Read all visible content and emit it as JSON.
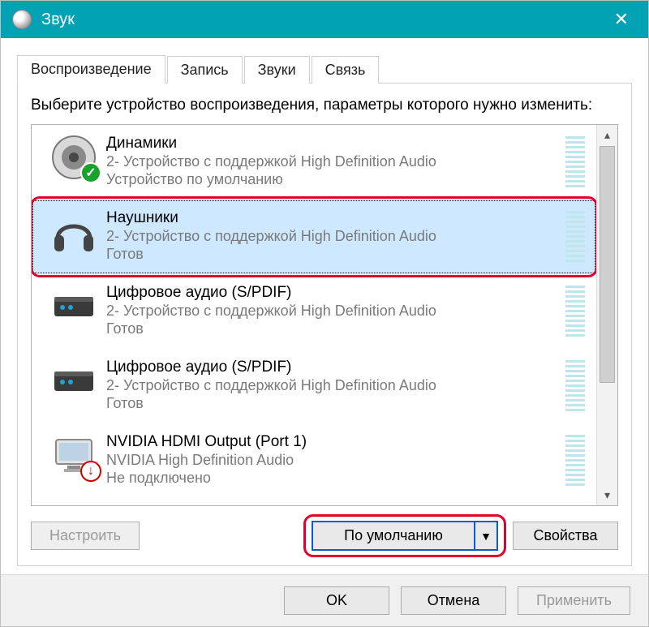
{
  "window": {
    "title": "Звук"
  },
  "tabs": [
    {
      "label": "Воспроизведение",
      "active": true
    },
    {
      "label": "Запись",
      "active": false
    },
    {
      "label": "Звуки",
      "active": false
    },
    {
      "label": "Связь",
      "active": false
    }
  ],
  "instruction": "Выберите устройство воспроизведения, параметры которого нужно изменить:",
  "devices": [
    {
      "name": "Динамики",
      "desc": "2- Устройство с поддержкой High Definition Audio",
      "status": "Устройство по умолчанию",
      "icon": "speaker",
      "badge": "default",
      "selected": false,
      "highlighted": false
    },
    {
      "name": "Наушники",
      "desc": "2- Устройство с поддержкой High Definition Audio",
      "status": "Готов",
      "icon": "headphones",
      "badge": null,
      "selected": true,
      "highlighted": true
    },
    {
      "name": "Цифровое аудио (S/PDIF)",
      "desc": "2- Устройство с поддержкой High Definition Audio",
      "status": "Готов",
      "icon": "spdif",
      "badge": null,
      "selected": false,
      "highlighted": false
    },
    {
      "name": "Цифровое аудио (S/PDIF)",
      "desc": "2- Устройство с поддержкой High Definition Audio",
      "status": "Готов",
      "icon": "spdif",
      "badge": null,
      "selected": false,
      "highlighted": false
    },
    {
      "name": "NVIDIA HDMI Output (Port 1)",
      "desc": "NVIDIA High Definition Audio",
      "status": "Не подключено",
      "icon": "monitor",
      "badge": "error",
      "selected": false,
      "highlighted": false
    }
  ],
  "buttons": {
    "configure": "Настроить",
    "set_default": "По умолчанию",
    "properties": "Свойства",
    "ok": "OK",
    "cancel": "Отмена",
    "apply": "Применить"
  },
  "default_button_highlighted": true,
  "configure_disabled": true,
  "apply_disabled": true
}
